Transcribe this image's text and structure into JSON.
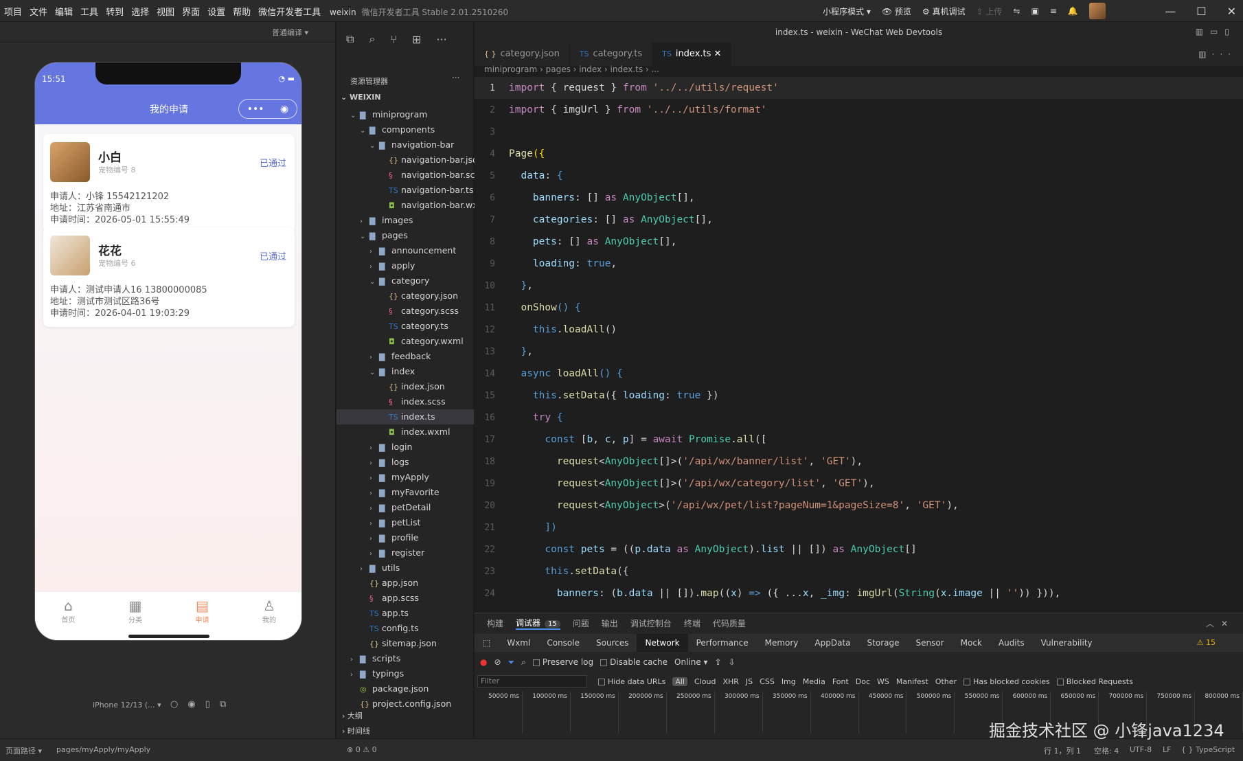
{
  "menubar": {
    "items": [
      "项目",
      "文件",
      "编辑",
      "工具",
      "转到",
      "选择",
      "视图",
      "界面",
      "设置",
      "帮助",
      "微信开发者工具"
    ],
    "project": "weixin",
    "app_title": "微信开发者工具 Stable 2.01.2510260",
    "tools": [
      "小程序模式 ▾",
      "预览",
      "真机调试",
      "上传"
    ]
  },
  "simulator": {
    "mode_label": "普通编译 ▾",
    "time": "15:51",
    "page_title": "我的申请",
    "cards": [
      {
        "name": "小白",
        "pet_no": "宠物编号 8",
        "status": "已通过",
        "applicant": "申请人：小锋 15542121202",
        "address": "地址：江苏省南通市",
        "time": "申请时间：2026-05-01 15:55:49"
      },
      {
        "name": "花花",
        "pet_no": "宠物编号 6",
        "status": "已通过",
        "applicant": "申请人：测试申请人16 13800000085",
        "address": "地址：测试市测试区路36号",
        "time": "申请时间：2026-04-01 19:03:29"
      }
    ],
    "tabs": [
      {
        "label": "首页",
        "icon": "home-icon"
      },
      {
        "label": "分类",
        "icon": "grid-icon"
      },
      {
        "label": "申请",
        "icon": "document-icon"
      },
      {
        "label": "我的",
        "icon": "user-icon"
      }
    ],
    "device": "iPhone 12/13 (... ▾"
  },
  "explorer": {
    "header": "资源管理器",
    "section": "WEIXIN",
    "tree": [
      {
        "d": 1,
        "n": "miniprogram",
        "t": "folder",
        "o": true
      },
      {
        "d": 2,
        "n": "components",
        "t": "folder",
        "o": true
      },
      {
        "d": 3,
        "n": "navigation-bar",
        "t": "folder",
        "o": true
      },
      {
        "d": 4,
        "n": "navigation-bar.json",
        "t": "json"
      },
      {
        "d": 4,
        "n": "navigation-bar.scss",
        "t": "scss"
      },
      {
        "d": 4,
        "n": "navigation-bar.ts",
        "t": "ts"
      },
      {
        "d": 4,
        "n": "navigation-bar.wxml",
        "t": "wxml"
      },
      {
        "d": 2,
        "n": "images",
        "t": "folder",
        "o": false
      },
      {
        "d": 2,
        "n": "pages",
        "t": "folder",
        "o": true
      },
      {
        "d": 3,
        "n": "announcement",
        "t": "folder",
        "o": false
      },
      {
        "d": 3,
        "n": "apply",
        "t": "folder",
        "o": false
      },
      {
        "d": 3,
        "n": "category",
        "t": "folder",
        "o": true
      },
      {
        "d": 4,
        "n": "category.json",
        "t": "json"
      },
      {
        "d": 4,
        "n": "category.scss",
        "t": "scss"
      },
      {
        "d": 4,
        "n": "category.ts",
        "t": "ts"
      },
      {
        "d": 4,
        "n": "category.wxml",
        "t": "wxml"
      },
      {
        "d": 3,
        "n": "feedback",
        "t": "folder",
        "o": false
      },
      {
        "d": 3,
        "n": "index",
        "t": "folder",
        "o": true
      },
      {
        "d": 4,
        "n": "index.json",
        "t": "json"
      },
      {
        "d": 4,
        "n": "index.scss",
        "t": "scss"
      },
      {
        "d": 4,
        "n": "index.ts",
        "t": "ts",
        "sel": true
      },
      {
        "d": 4,
        "n": "index.wxml",
        "t": "wxml"
      },
      {
        "d": 3,
        "n": "login",
        "t": "folder",
        "o": false
      },
      {
        "d": 3,
        "n": "logs",
        "t": "folder",
        "o": false
      },
      {
        "d": 3,
        "n": "myApply",
        "t": "folder",
        "o": false
      },
      {
        "d": 3,
        "n": "myFavorite",
        "t": "folder",
        "o": false
      },
      {
        "d": 3,
        "n": "petDetail",
        "t": "folder",
        "o": false
      },
      {
        "d": 3,
        "n": "petList",
        "t": "folder",
        "o": false
      },
      {
        "d": 3,
        "n": "profile",
        "t": "folder",
        "o": false
      },
      {
        "d": 3,
        "n": "register",
        "t": "folder",
        "o": false
      },
      {
        "d": 2,
        "n": "utils",
        "t": "folder",
        "o": false
      },
      {
        "d": 2,
        "n": "app.json",
        "t": "json"
      },
      {
        "d": 2,
        "n": "app.scss",
        "t": "scss"
      },
      {
        "d": 2,
        "n": "app.ts",
        "t": "ts"
      },
      {
        "d": 2,
        "n": "config.ts",
        "t": "ts"
      },
      {
        "d": 2,
        "n": "sitemap.json",
        "t": "json"
      },
      {
        "d": 1,
        "n": "scripts",
        "t": "folder",
        "o": false
      },
      {
        "d": 1,
        "n": "typings",
        "t": "folder",
        "o": false
      },
      {
        "d": 1,
        "n": "package.json",
        "t": "pkg"
      },
      {
        "d": 1,
        "n": "project.config.json",
        "t": "json"
      }
    ],
    "outline": "大纲",
    "timeline": "时间线"
  },
  "editor": {
    "window_title": "index.ts - weixin - WeChat Web Devtools",
    "tabs": [
      {
        "label": "category.json",
        "icon": "{ }"
      },
      {
        "label": "category.ts",
        "icon": "TS"
      },
      {
        "label": "index.ts",
        "icon": "TS",
        "active": true
      }
    ],
    "breadcrumb": "miniprogram › pages › index › index.ts › ...",
    "lines": [
      [
        [
          "k",
          "import"
        ],
        [
          "p",
          " { request } "
        ],
        [
          "k",
          "from"
        ],
        [
          "s",
          " '../../utils/request'"
        ]
      ],
      [
        [
          "k",
          "import"
        ],
        [
          "p",
          " { imgUrl } "
        ],
        [
          "k",
          "from"
        ],
        [
          "s",
          " '../../utils/format'"
        ]
      ],
      [],
      [
        [
          "f",
          "Page"
        ],
        [
          "y",
          "({"
        ]
      ],
      [
        [
          "v",
          "  data"
        ],
        [
          "p",
          ": "
        ],
        [
          "b",
          "{"
        ]
      ],
      [
        [
          "v",
          "    banners"
        ],
        [
          "p",
          ": [] "
        ],
        [
          "k",
          "as"
        ],
        [
          "t",
          " AnyObject"
        ],
        [
          "p",
          "[],"
        ]
      ],
      [
        [
          "v",
          "    categories"
        ],
        [
          "p",
          ": [] "
        ],
        [
          "k",
          "as"
        ],
        [
          "t",
          " AnyObject"
        ],
        [
          "p",
          "[],"
        ]
      ],
      [
        [
          "v",
          "    pets"
        ],
        [
          "p",
          ": [] "
        ],
        [
          "k",
          "as"
        ],
        [
          "t",
          " AnyObject"
        ],
        [
          "p",
          "[],"
        ]
      ],
      [
        [
          "v",
          "    loading"
        ],
        [
          "p",
          ": "
        ],
        [
          "b",
          "true"
        ],
        [
          "p",
          ","
        ]
      ],
      [
        [
          "b",
          "  }"
        ],
        [
          "p",
          ","
        ]
      ],
      [
        [
          "f",
          "  onShow"
        ],
        [
          "b",
          "() {"
        ]
      ],
      [
        [
          "b",
          "    this"
        ],
        [
          "p",
          "."
        ],
        [
          "f",
          "loadAll"
        ],
        [
          "p",
          "()"
        ]
      ],
      [
        [
          "b",
          "  }"
        ],
        [
          "p",
          ","
        ]
      ],
      [
        [
          "b",
          "  async"
        ],
        [
          "f",
          " loadAll"
        ],
        [
          "b",
          "() {"
        ]
      ],
      [
        [
          "b",
          "    this"
        ],
        [
          "p",
          "."
        ],
        [
          "f",
          "setData"
        ],
        [
          "p",
          "({ "
        ],
        [
          "v",
          "loading"
        ],
        [
          "p",
          ": "
        ],
        [
          "b",
          "true"
        ],
        [
          "p",
          " })"
        ]
      ],
      [
        [
          "k",
          "    try"
        ],
        [
          "b",
          " {"
        ]
      ],
      [
        [
          "b",
          "      const"
        ],
        [
          "p",
          " ["
        ],
        [
          "v",
          "b"
        ],
        [
          "p",
          ", "
        ],
        [
          "v",
          "c"
        ],
        [
          "p",
          ", "
        ],
        [
          "v",
          "p"
        ],
        [
          "p",
          "] = "
        ],
        [
          "k",
          "await"
        ],
        [
          "t",
          " Promise"
        ],
        [
          "p",
          "."
        ],
        [
          "f",
          "all"
        ],
        [
          "p",
          "(["
        ]
      ],
      [
        [
          "f",
          "        request"
        ],
        [
          "p",
          "<"
        ],
        [
          "t",
          "AnyObject"
        ],
        [
          "p",
          "[]>("
        ],
        [
          "s",
          "'/api/wx/banner/list'"
        ],
        [
          "p",
          ", "
        ],
        [
          "s",
          "'GET'"
        ],
        [
          "p",
          "),"
        ]
      ],
      [
        [
          "f",
          "        request"
        ],
        [
          "p",
          "<"
        ],
        [
          "t",
          "AnyObject"
        ],
        [
          "p",
          "[]>("
        ],
        [
          "s",
          "'/api/wx/category/list'"
        ],
        [
          "p",
          ", "
        ],
        [
          "s",
          "'GET'"
        ],
        [
          "p",
          "),"
        ]
      ],
      [
        [
          "f",
          "        request"
        ],
        [
          "p",
          "<"
        ],
        [
          "t",
          "AnyObject"
        ],
        [
          "p",
          ">("
        ],
        [
          "s",
          "'/api/wx/pet/list?pageNum=1&pageSize=8'"
        ],
        [
          "p",
          ", "
        ],
        [
          "s",
          "'GET'"
        ],
        [
          "p",
          "),"
        ]
      ],
      [
        [
          "b",
          "      ])"
        ]
      ],
      [
        [
          "b",
          "      const"
        ],
        [
          "v",
          " pets"
        ],
        [
          "p",
          " = (("
        ],
        [
          "v",
          "p"
        ],
        [
          "p",
          "."
        ],
        [
          "v",
          "data"
        ],
        [
          "k",
          " as"
        ],
        [
          "t",
          " AnyObject"
        ],
        [
          "p",
          ")."
        ],
        [
          "v",
          "list"
        ],
        [
          "p",
          " || []) "
        ],
        [
          "k",
          "as"
        ],
        [
          "t",
          " AnyObject"
        ],
        [
          "p",
          "[]"
        ]
      ],
      [
        [
          "b",
          "      this"
        ],
        [
          "p",
          "."
        ],
        [
          "f",
          "setData"
        ],
        [
          "p",
          "({"
        ]
      ],
      [
        [
          "v",
          "        banners"
        ],
        [
          "p",
          ": ("
        ],
        [
          "v",
          "b"
        ],
        [
          "p",
          "."
        ],
        [
          "v",
          "data"
        ],
        [
          "p",
          " || [])."
        ],
        [
          "f",
          "map"
        ],
        [
          "p",
          "(("
        ],
        [
          "v",
          "x"
        ],
        [
          "p",
          ") "
        ],
        [
          "b",
          "=>"
        ],
        [
          "p",
          " ({ ..."
        ],
        [
          "v",
          "x"
        ],
        [
          "p",
          ", "
        ],
        [
          "v",
          "_img"
        ],
        [
          "p",
          ": "
        ],
        [
          "f",
          "imgUrl"
        ],
        [
          "p",
          "("
        ],
        [
          "t",
          "String"
        ],
        [
          "p",
          "("
        ],
        [
          "v",
          "x"
        ],
        [
          "p",
          "."
        ],
        [
          "v",
          "image"
        ],
        [
          "p",
          " || "
        ],
        [
          "s",
          "''"
        ],
        [
          "p",
          ")) })),"
        ]
      ]
    ]
  },
  "devtools": {
    "top_tabs": [
      "构建",
      "调试器",
      "问题",
      "输出",
      "调试控制台",
      "终端",
      "代码质量"
    ],
    "debugger_count": "15",
    "panels": [
      "Wxml",
      "Console",
      "Sources",
      "Network",
      "Performance",
      "Memory",
      "AppData",
      "Storage",
      "Sensor",
      "Mock",
      "Audits",
      "Vulnerability"
    ],
    "warnings": "15",
    "preserve_log": "Preserve log",
    "disable_cache": "Disable cache",
    "throttle": "Online",
    "filter_placeholder": "Filter",
    "hide_data_urls": "Hide data URLs",
    "types": [
      "All",
      "Cloud",
      "XHR",
      "JS",
      "CSS",
      "Img",
      "Media",
      "Font",
      "Doc",
      "WS",
      "Manifest",
      "Other"
    ],
    "has_blocked": "Has blocked cookies",
    "blocked_req": "Blocked Requests",
    "ticks": [
      "50000 ms",
      "100000 ms",
      "150000 ms",
      "200000 ms",
      "250000 ms",
      "300000 ms",
      "350000 ms",
      "400000 ms",
      "450000 ms",
      "500000 ms",
      "550000 ms",
      "600000 ms",
      "650000 ms",
      "700000 ms",
      "750000 ms",
      "800000 ms"
    ]
  },
  "status": {
    "page_path_label": "页面路径 ▾",
    "page_path": "pages/myApply/myApply",
    "problems": "⊗ 0 ⚠ 0",
    "cursor": "行 1，列 1",
    "spaces": "空格: 4",
    "encoding": "UTF-8",
    "eol": "LF",
    "lang": "{ } TypeScript"
  },
  "watermark": "掘金技术社区 @ 小锋java1234",
  "colors": {
    "accent": "#6576e0",
    "status_passed": "#5b6fd6",
    "tab_active": "#f08a5d"
  }
}
